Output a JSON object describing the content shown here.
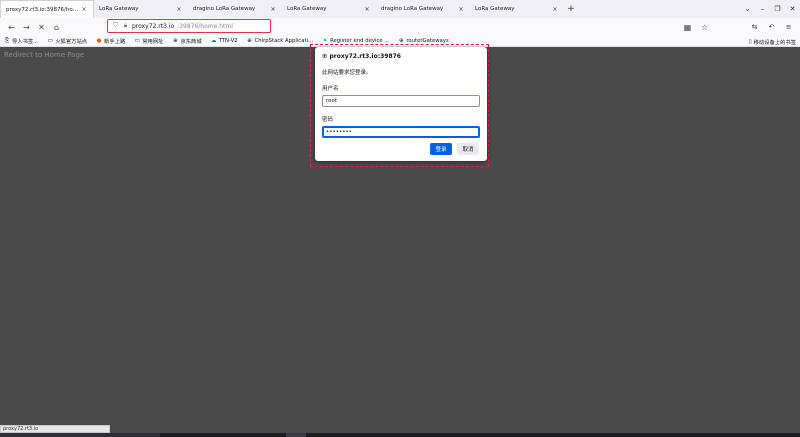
{
  "tabs": [
    {
      "label": "proxy72.rt3.io:39876/home.html",
      "active": true
    },
    {
      "label": "LoRa Gateway",
      "active": false
    },
    {
      "label": "dragino LoRa Gateway",
      "active": false
    },
    {
      "label": "LoRa Gateway",
      "active": false
    },
    {
      "label": "dragino LoRa Gateway",
      "active": false
    },
    {
      "label": "LoRa Gateway",
      "active": false
    }
  ],
  "tab_close_glyph": "×",
  "new_tab_glyph": "+",
  "window": {
    "list_glyph": "⌄",
    "minimize_glyph": "–",
    "restore_glyph": "❐",
    "close_glyph": "✕"
  },
  "navbar": {
    "back_glyph": "←",
    "forward_glyph": "→",
    "stop_glyph": "✕",
    "home_glyph": "⌂",
    "url_host": "proxy72.rt3.io",
    "url_path": ":39876/home.html",
    "qr_glyph": "▦",
    "star_glyph": "☆",
    "ext1_glyph": "⇆",
    "ext2_glyph": "↶",
    "menu_glyph": "≡"
  },
  "bookmarks": [
    {
      "label": "导入书签...",
      "icon": "⎘",
      "icon_name": "import-icon"
    },
    {
      "label": "火狐官方站点",
      "icon": "▭",
      "icon_name": "folder-icon"
    },
    {
      "label": "新手上路",
      "icon": "●",
      "icon_name": "firefox-icon"
    },
    {
      "label": "常用网址",
      "icon": "▭",
      "icon_name": "folder-icon"
    },
    {
      "label": "京东商城",
      "icon": "⊕",
      "icon_name": "globe-icon"
    },
    {
      "label": "TTN-V2",
      "icon": "☁",
      "icon_name": "cloud-icon"
    },
    {
      "label": "ChirpStack Applicati...",
      "icon": "⊕",
      "icon_name": "globe-icon"
    },
    {
      "label": "Register end device ...",
      "icon": "✦",
      "icon_name": "ttn-icon"
    },
    {
      "label": "routerGateways",
      "icon": "⊕",
      "icon_name": "globe-icon"
    }
  ],
  "bookmarks_right": {
    "label": "移动设备上的书签",
    "icon": "▯"
  },
  "page": {
    "redirect_text": "Redirect to Home Page"
  },
  "dialog": {
    "host": "proxy72.rt3.io:39876",
    "message": "此网站要求您登录。",
    "username_label": "用户名",
    "username_value": "root",
    "password_label": "密码",
    "password_value": "••••••••",
    "login_label": "登录",
    "cancel_label": "取消"
  },
  "status": {
    "url": "proxy72.rt3.io"
  },
  "colors": {
    "accent": "#0061e0",
    "highlight": "#e0334a",
    "page_bg": "#4a4a4a"
  }
}
